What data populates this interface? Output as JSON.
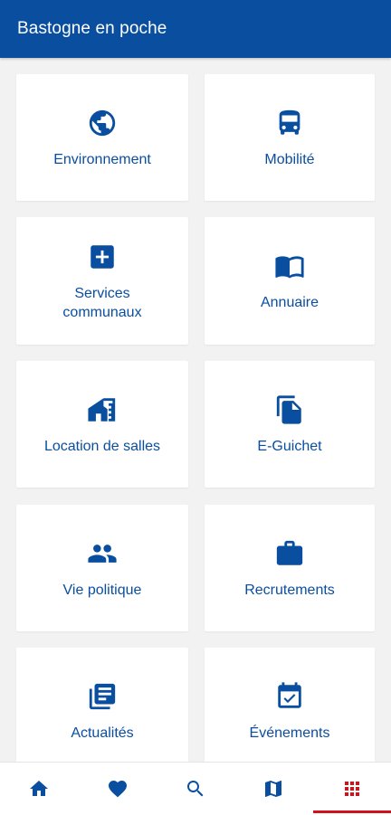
{
  "app": {
    "title": "Bastogne en poche"
  },
  "menu": [
    {
      "label": "Environnement",
      "icon": "globe-icon"
    },
    {
      "label": "Mobilité",
      "icon": "bus-icon"
    },
    {
      "label": "Services communaux",
      "icon": "plus-box-icon"
    },
    {
      "label": "Annuaire",
      "icon": "book-icon"
    },
    {
      "label": "Location de salles",
      "icon": "house-icon"
    },
    {
      "label": "E-Guichet",
      "icon": "document-icon"
    },
    {
      "label": "Vie politique",
      "icon": "people-icon"
    },
    {
      "label": "Recrutements",
      "icon": "briefcase-icon"
    },
    {
      "label": "Actualités",
      "icon": "news-icon"
    },
    {
      "label": "Événements",
      "icon": "calendar-check-icon"
    }
  ],
  "bottom_nav": [
    {
      "name": "home",
      "icon": "home-icon"
    },
    {
      "name": "favorites",
      "icon": "heart-icon"
    },
    {
      "name": "search",
      "icon": "search-icon"
    },
    {
      "name": "map",
      "icon": "map-icon"
    },
    {
      "name": "menu-grid",
      "icon": "grid-icon",
      "active": true
    }
  ],
  "colors": {
    "primary": "#0a4ea0",
    "accent": "#d0121b",
    "background": "#f2f2f2"
  }
}
